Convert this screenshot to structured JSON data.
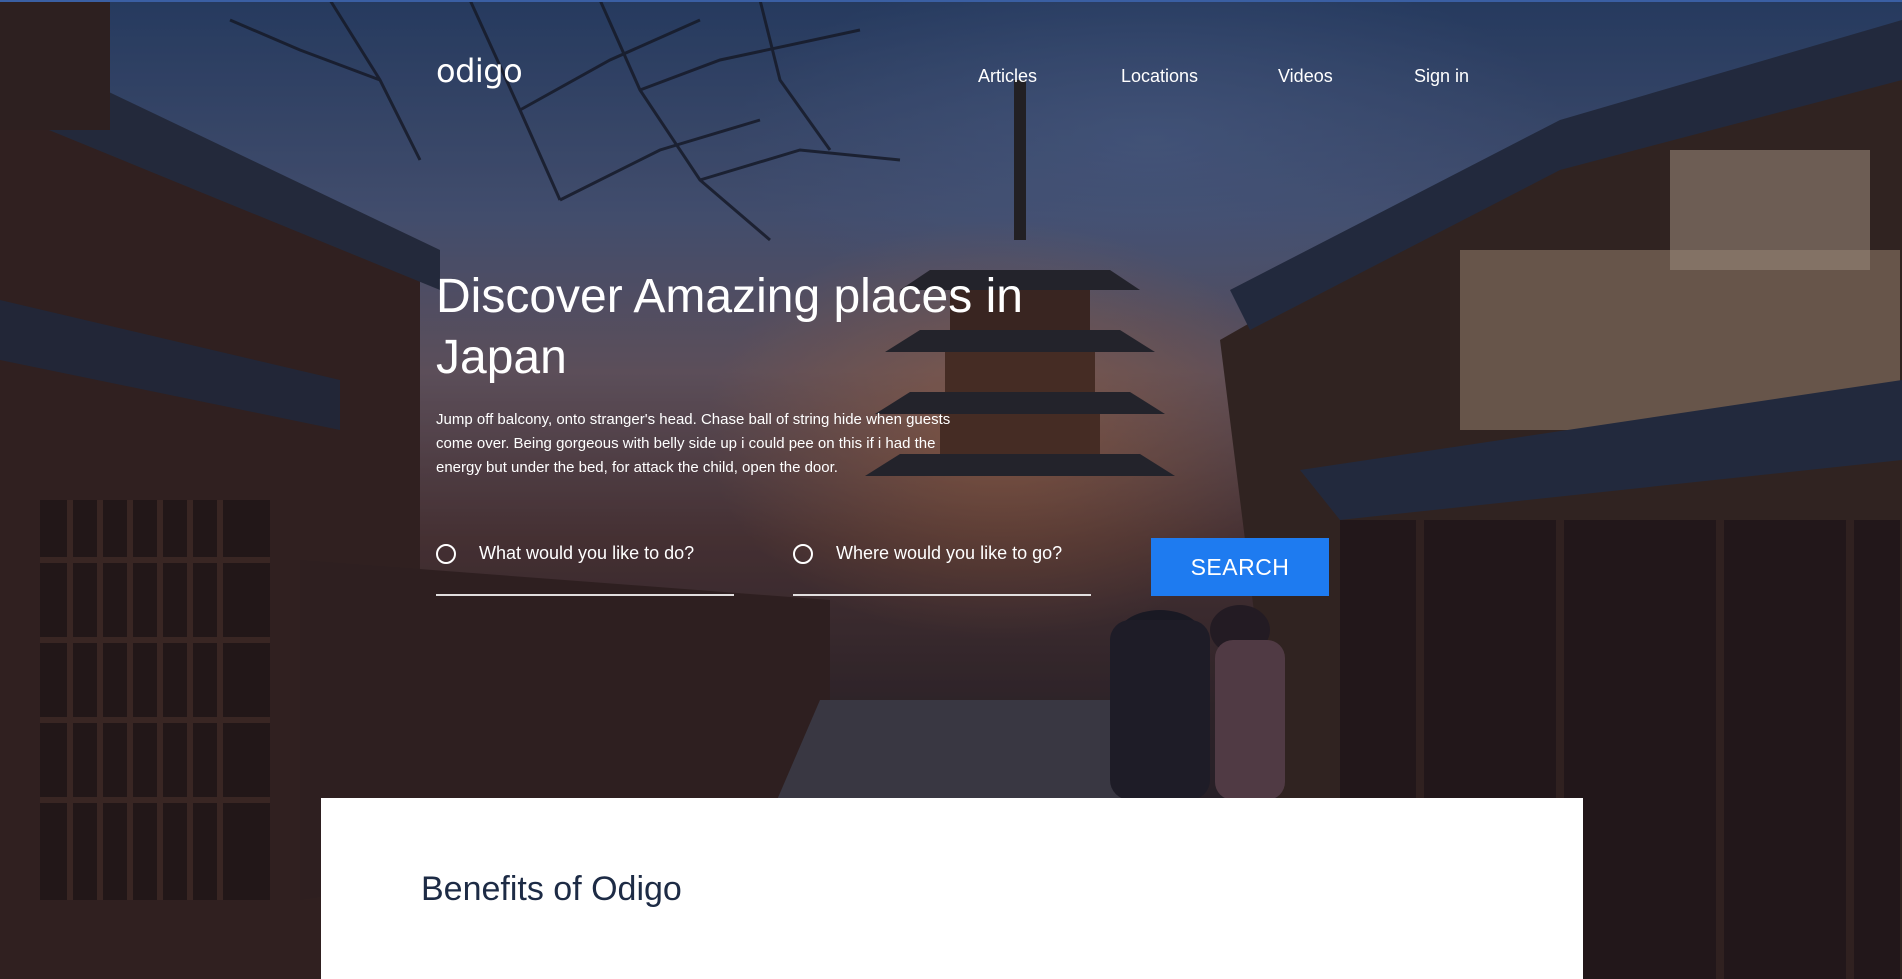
{
  "brand": {
    "logo": "odigo"
  },
  "nav": {
    "items": [
      "Articles",
      "Locations",
      "Videos",
      "Sign in"
    ]
  },
  "hero": {
    "headline": "Discover Amazing places in Japan",
    "description": "Jump off balcony, onto stranger's head. Chase ball of string hide when guests come over. Being gorgeous with belly side up i could pee on this if i had the energy but under the bed, for attack the child, open the door."
  },
  "search": {
    "what_placeholder": "What would you like to do?",
    "where_placeholder": "Where would you like to go?",
    "button_label": "SEARCH"
  },
  "benefits": {
    "title": "Benefits of Odigo"
  },
  "colors": {
    "accent": "#1e7bf0",
    "heading": "#1d2b45"
  }
}
